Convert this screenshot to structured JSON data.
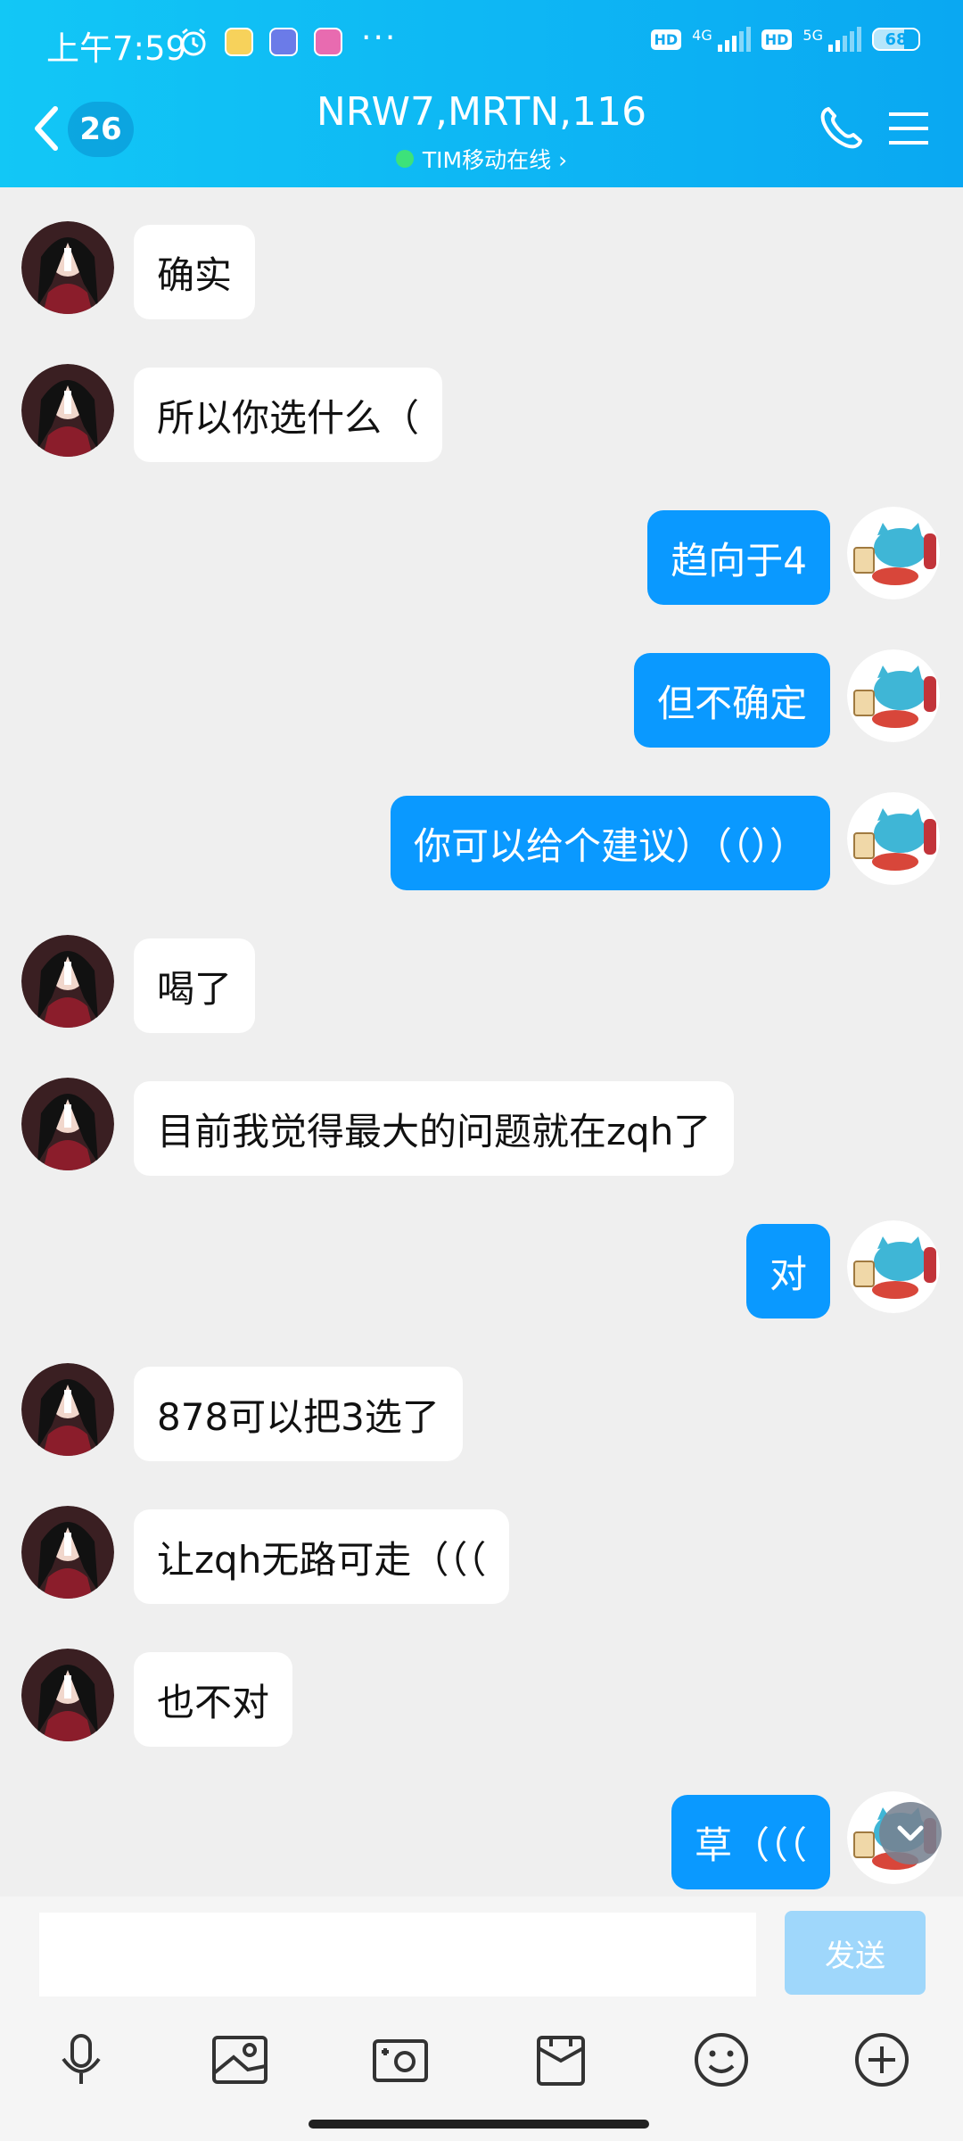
{
  "status_bar": {
    "time": "上午7:59",
    "net1": "4G",
    "net2": "5G",
    "hd": "HD",
    "battery": "68",
    "more": "···"
  },
  "header": {
    "unread_count": "26",
    "title": "NRW7,MRTN,116",
    "subtitle": "TIM移动在线 ›"
  },
  "messages": [
    {
      "side": "left",
      "text": "确实"
    },
    {
      "side": "left",
      "text": "所以你选什么（"
    },
    {
      "side": "right",
      "text": "趋向于4"
    },
    {
      "side": "right",
      "text": "但不确定"
    },
    {
      "side": "right",
      "text": "你可以给个建议）（（））"
    },
    {
      "side": "left",
      "text": "喝了"
    },
    {
      "side": "left",
      "text": "目前我觉得最大的问题就在zqh了"
    },
    {
      "side": "right",
      "text": "对"
    },
    {
      "side": "left",
      "text": "878可以把3选了"
    },
    {
      "side": "left",
      "text": "让zqh无路可走（（（"
    },
    {
      "side": "left",
      "text": "也不对"
    },
    {
      "side": "right",
      "text": "草（（（"
    }
  ],
  "input": {
    "value": "",
    "send_label": "发送"
  },
  "toolbar": [
    "mic-icon",
    "image-icon",
    "camera-icon",
    "gift-icon",
    "emoji-icon",
    "plus-icon"
  ],
  "colors": {
    "header": "#0aa8f2",
    "outgoing_bubble": "#0a99ff",
    "send_disabled": "#9fd7fb"
  }
}
